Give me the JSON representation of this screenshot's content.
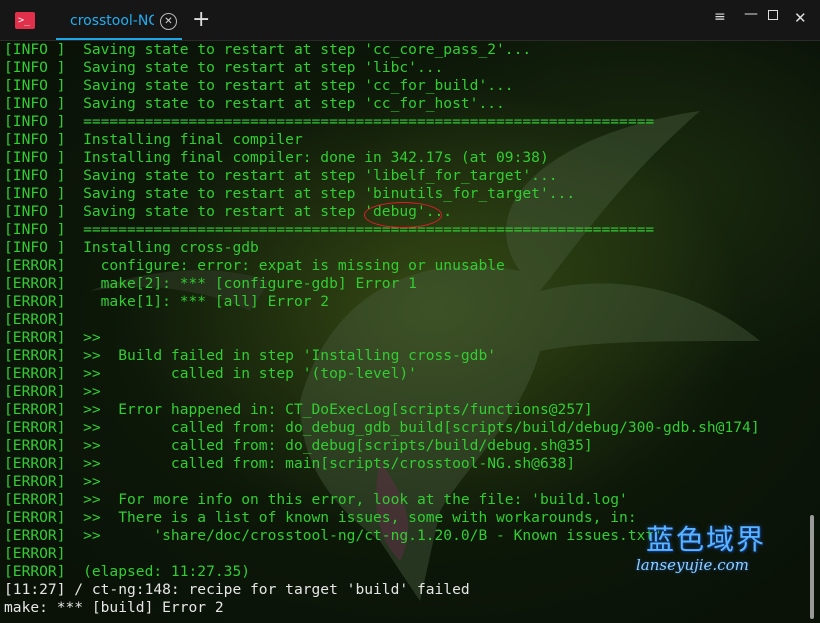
{
  "window": {
    "tab_title": "crosstool-NG",
    "tab_close_glyph": "✕",
    "new_tab_glyph": "+",
    "menu_glyph": "≡",
    "minimize_glyph": "—",
    "close_glyph": "✕",
    "app_icon_glyph": ">_",
    "accent_color": "#22aef2"
  },
  "terminal": {
    "lines": [
      "[INFO ]  Saving state to restart at step 'cc_core_pass_2'...",
      "[INFO ]  Saving state to restart at step 'libc'...",
      "[INFO ]  Saving state to restart at step 'cc_for_build'...",
      "[INFO ]  Saving state to restart at step 'cc_for_host'...",
      "[INFO ]  =================================================================",
      "[INFO ]  Installing final compiler",
      "[INFO ]  Installing final compiler: done in 342.17s (at 09:38)",
      "[INFO ]  Saving state to restart at step 'libelf_for_target'...",
      "[INFO ]  Saving state to restart at step 'binutils_for_target'...",
      "[INFO ]  Saving state to restart at step 'debug'...",
      "[INFO ]  =================================================================",
      "[INFO ]  Installing cross-gdb",
      "[ERROR]    configure: error: expat is missing or unusable",
      "[ERROR]    make[2]: *** [configure-gdb] Error 1",
      "[ERROR]    make[1]: *** [all] Error 2",
      "[ERROR]",
      "[ERROR]  >>",
      "[ERROR]  >>  Build failed in step 'Installing cross-gdb'",
      "[ERROR]  >>        called in step '(top-level)'",
      "[ERROR]  >>",
      "[ERROR]  >>  Error happened in: CT_DoExecLog[scripts/functions@257]",
      "[ERROR]  >>        called from: do_debug_gdb_build[scripts/build/debug/300-gdb.sh@174]",
      "[ERROR]  >>        called from: do_debug[scripts/build/debug.sh@35]",
      "[ERROR]  >>        called from: main[scripts/crosstool-NG.sh@638]",
      "[ERROR]  >>",
      "[ERROR]  >>  For more info on this error, look at the file: 'build.log'",
      "[ERROR]  >>  There is a list of known issues, some with workarounds, in:",
      "[ERROR]  >>      'share/doc/crosstool-ng/ct-ng.1.20.0/B - Known issues.txt'",
      "[ERROR]",
      "[ERROR]  (elapsed: 11:27.35)",
      "[11:27] / ct-ng:148: recipe for target 'build' failed",
      "make: *** [build] Error 2"
    ],
    "text_color": "#32cd32",
    "highlight_color": "#e21b2b"
  },
  "watermark": {
    "chinese": "蓝色域界",
    "latin": "lanseyujie.com"
  }
}
